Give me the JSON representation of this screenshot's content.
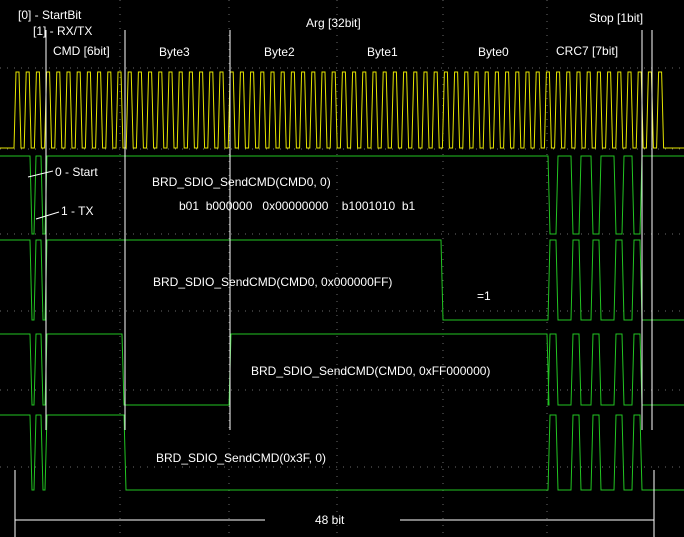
{
  "labels": {
    "start_bit": "[0] - StartBit",
    "rxtx": "[1] - RX/TX",
    "cmd": "CMD [6bit]",
    "arg": "Arg [32bit]",
    "stop": "Stop [1bit]",
    "byte3": "Byte3",
    "byte2": "Byte2",
    "byte1": "Byte1",
    "byte0": "Byte0",
    "crc7": "CRC7 [7bit]",
    "zero_start": "0 - Start",
    "one_tx": "1 - TX",
    "total_bits": "48 bit"
  },
  "traces": [
    {
      "caption": "BRD_SDIO_SendCMD(CMD0, 0)",
      "bits": "b01  b000000   0x00000000    b1001010  b1"
    },
    {
      "caption": "BRD_SDIO_SendCMD(CMD0, 0x000000FF)",
      "note": "=1"
    },
    {
      "caption": "BRD_SDIO_SendCMD(CMD0, 0xFF000000)"
    },
    {
      "caption": "BRD_SDIO_SendCMD(0x3F, 0)"
    }
  ],
  "colors": {
    "background": "#000000",
    "clock": "#e6e600",
    "data": "#22c522",
    "grid": "#6a6a6a",
    "marker": "#ffffff"
  }
}
